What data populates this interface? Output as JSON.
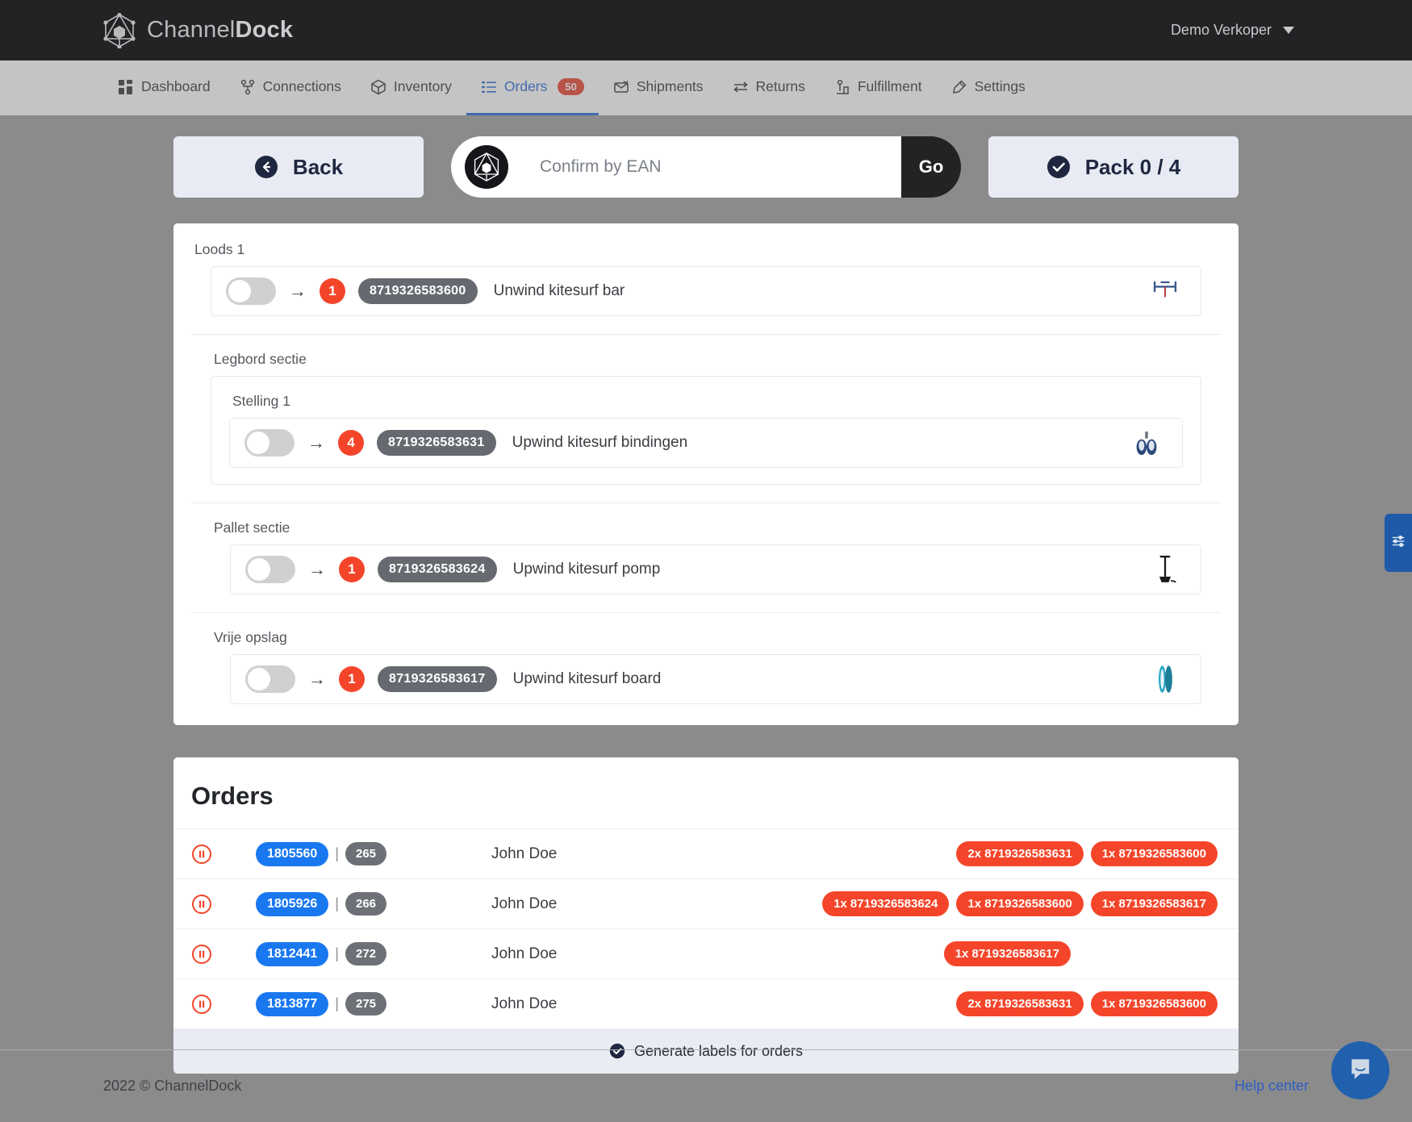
{
  "topbar": {
    "brand_light": "Channel",
    "brand_bold": "Dock",
    "logo_icon": "channeldock-logo-icon",
    "user_name": "Demo Verkoper",
    "caret_icon": "chevron-down-icon"
  },
  "nav": {
    "items": [
      {
        "label": "Dashboard",
        "icon": "dashboard-grid-icon",
        "active": false,
        "badge": null
      },
      {
        "label": "Connections",
        "icon": "connections-node-icon",
        "active": false,
        "badge": null
      },
      {
        "label": "Inventory",
        "icon": "box-icon",
        "active": false,
        "badge": null
      },
      {
        "label": "Orders",
        "icon": "list-icon",
        "active": true,
        "badge": "50"
      },
      {
        "label": "Shipments",
        "icon": "shipment-envelope-icon",
        "active": false,
        "badge": null
      },
      {
        "label": "Returns",
        "icon": "returns-arrows-icon",
        "active": false,
        "badge": null
      },
      {
        "label": "Fulfillment",
        "icon": "fulfillment-icon",
        "active": false,
        "badge": null
      },
      {
        "label": "Settings",
        "icon": "settings-icon",
        "active": false,
        "badge": null
      }
    ]
  },
  "toolbar": {
    "back_label": "Back",
    "back_icon": "arrow-left-circle-icon",
    "ean_placeholder": "Confirm by EAN",
    "ean_value": "",
    "ean_logo_icon": "channeldock-mark-icon",
    "go_label": "Go",
    "pack_label": "Pack 0 / 4",
    "pack_icon": "check-circle-icon"
  },
  "pick_list": {
    "warehouse_label": "Loods 1",
    "top_row": {
      "toggle_on": false,
      "arrow": "→",
      "qty": "1",
      "ean": "8719326583600",
      "product": "Unwind kitesurf bar",
      "thumb_icon": "kitesurf-bar-thumb"
    },
    "sections": [
      {
        "label": "Legbord sectie",
        "sub_label": "Stelling 1",
        "rows": [
          {
            "toggle_on": false,
            "arrow": "→",
            "qty": "4",
            "ean": "8719326583631",
            "product": "Upwind kitesurf bindingen",
            "thumb_icon": "kitesurf-bindings-thumb"
          }
        ]
      },
      {
        "label": "Pallet sectie",
        "sub_label": null,
        "rows": [
          {
            "toggle_on": false,
            "arrow": "→",
            "qty": "1",
            "ean": "8719326583624",
            "product": "Upwind kitesurf pomp",
            "thumb_icon": "kitesurf-pump-thumb"
          }
        ]
      },
      {
        "label": "Vrije opslag",
        "sub_label": null,
        "rows": [
          {
            "toggle_on": false,
            "arrow": "→",
            "qty": "1",
            "ean": "8719326583617",
            "product": "Upwind kitesurf board",
            "thumb_icon": "kitesurf-board-thumb"
          }
        ]
      }
    ]
  },
  "orders": {
    "title": "Orders",
    "separator": "|",
    "status_icon": "pause-circle-icon",
    "rows": [
      {
        "order_id": "1805560",
        "number": "265",
        "customer": "John Doe",
        "tags": [
          "2x 8719326583631",
          "1x 8719326583600"
        ]
      },
      {
        "order_id": "1805926",
        "number": "266",
        "customer": "John Doe",
        "tags": [
          "1x 8719326583624",
          "1x 8719326583600",
          "1x 8719326583617"
        ]
      },
      {
        "order_id": "1812441",
        "number": "272",
        "customer": "John Doe",
        "tags": [
          "1x 8719326583617"
        ]
      },
      {
        "order_id": "1813877",
        "number": "275",
        "customer": "John Doe",
        "tags": [
          "2x 8719326583631",
          "1x 8719326583600"
        ]
      }
    ],
    "footer_label": "Generate labels for orders",
    "footer_icon": "check-circle-icon"
  },
  "footer": {
    "copyright": "2022 © ChannelDock",
    "help_label": "Help center"
  },
  "widgets": {
    "side_tab_icon": "sliders-filter-icon",
    "chat_icon": "chat-bubble-icon"
  },
  "colors": {
    "accent_red": "#f4452a",
    "accent_blue": "#1978f0",
    "nav_active": "#2f6fde",
    "dark": "#232326",
    "button_bg": "#e8ebf3"
  }
}
